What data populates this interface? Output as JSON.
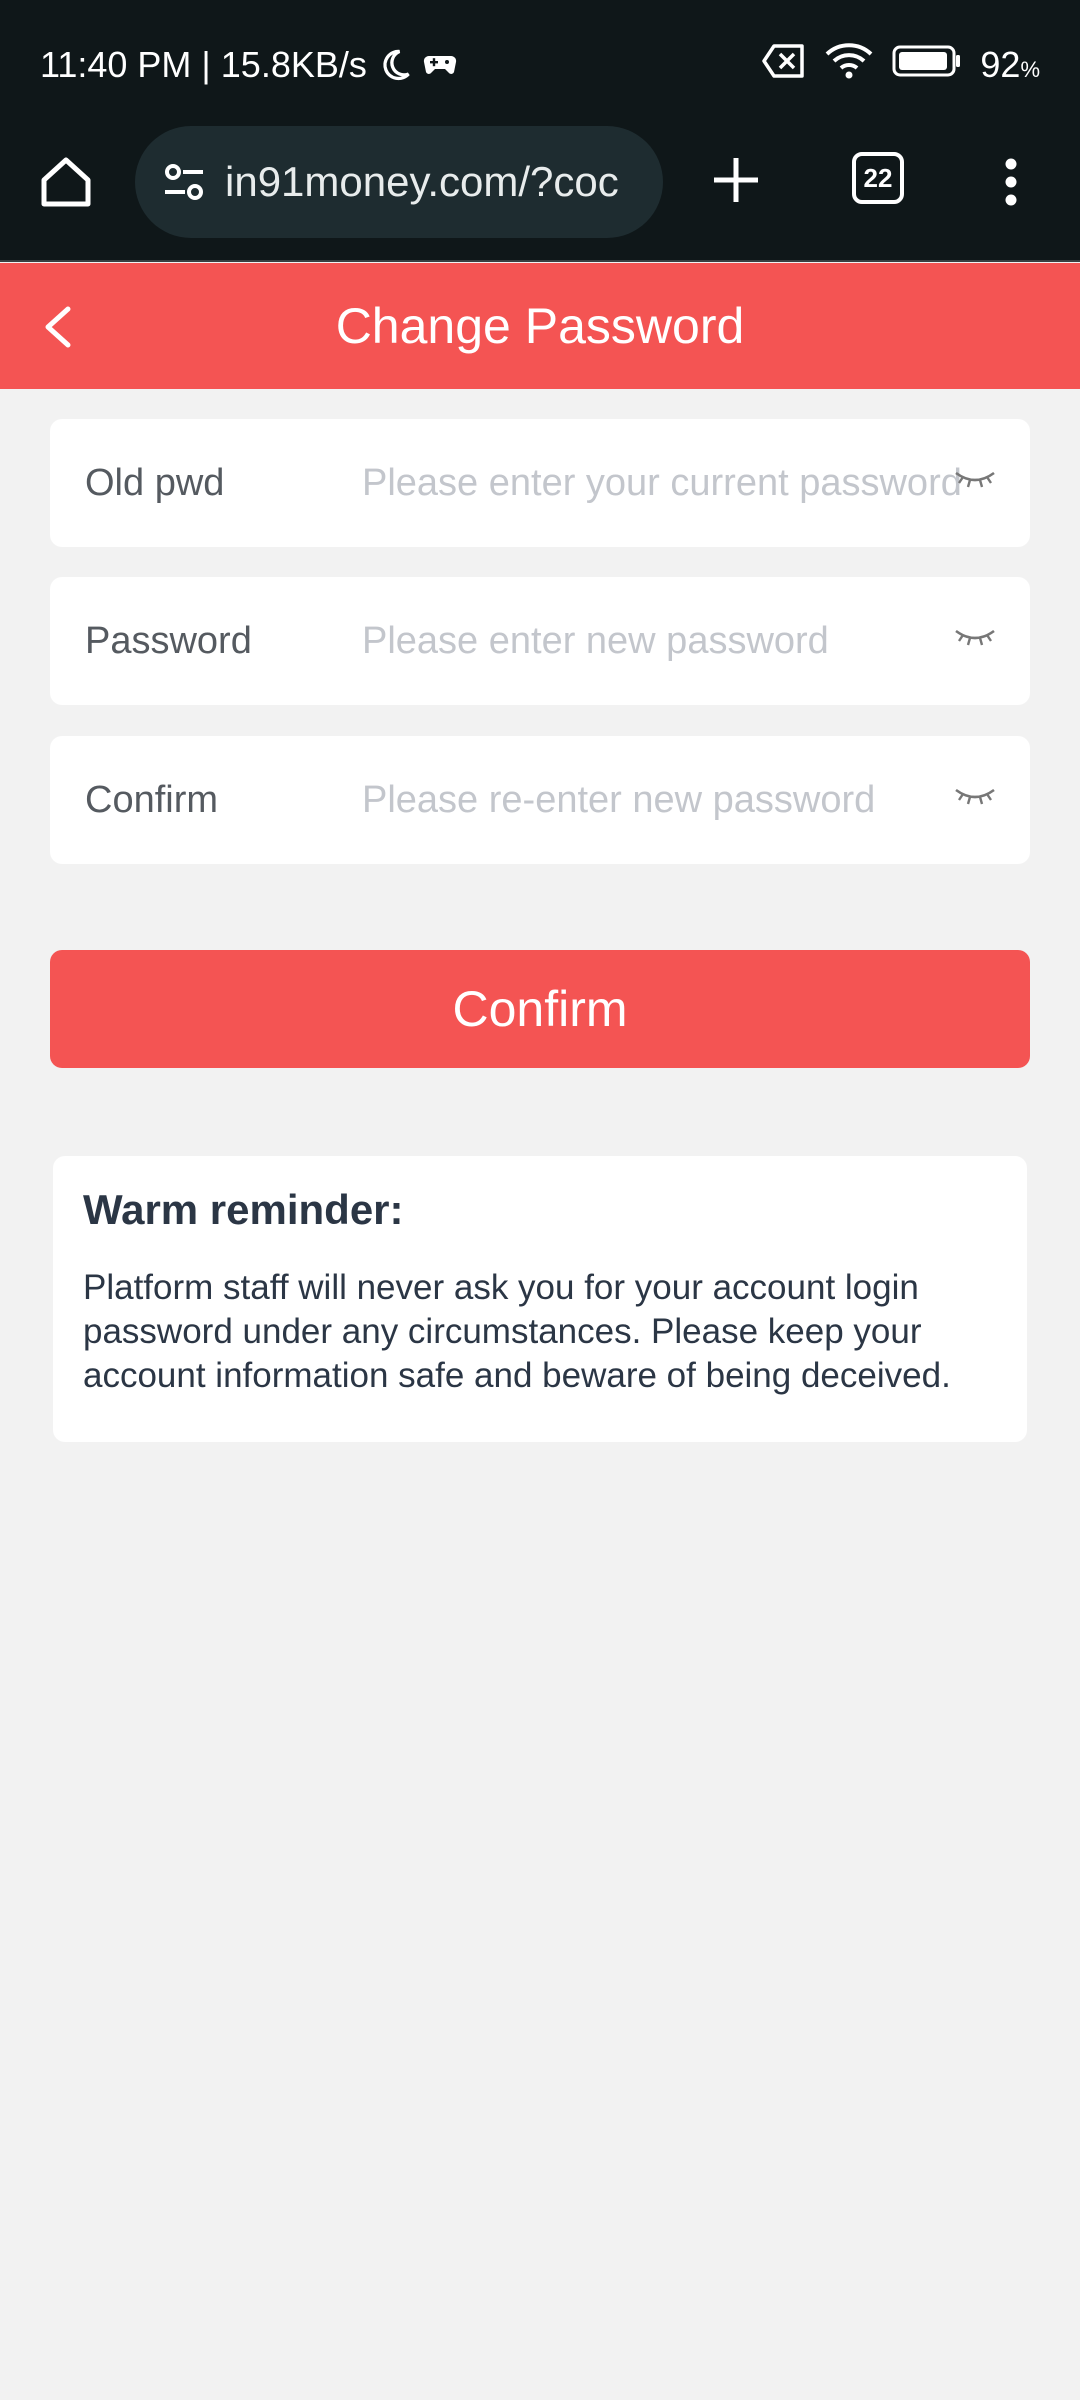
{
  "status_bar": {
    "time_speed": "11:40 PM | 15.8KB/s",
    "battery": "92",
    "battery_unit": "%"
  },
  "browser": {
    "url": "in91money.com/?coc",
    "tab_count": "22"
  },
  "header": {
    "title": "Change Password"
  },
  "form": {
    "old": {
      "label": "Old pwd",
      "placeholder": "Please enter your current password"
    },
    "new": {
      "label": "Password",
      "placeholder": "Please enter new password"
    },
    "confirm": {
      "label": "Confirm",
      "placeholder": "Please re-enter new password"
    },
    "submit_label": "Confirm"
  },
  "reminder": {
    "title": "Warm reminder:",
    "text": "Platform staff will never ask you for your account login password under any circumstances. Please keep your account information safe and beware of being deceived."
  },
  "colors": {
    "accent": "#f45453",
    "chrome": "#0f1719",
    "background": "#f2f2f2"
  }
}
